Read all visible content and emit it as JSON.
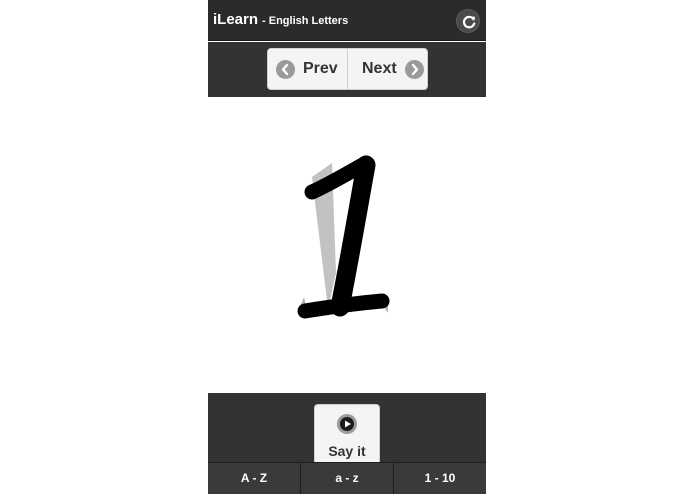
{
  "header": {
    "app_name": "iLearn",
    "subtitle": "- English Letters",
    "refresh_icon": "refresh-icon"
  },
  "nav": {
    "prev_label": "Prev",
    "next_label": "Next",
    "prev_icon": "chevron-left-icon",
    "next_icon": "chevron-right-icon"
  },
  "content": {
    "current_character": "1"
  },
  "footer": {
    "say_label": "Say it",
    "play_icon": "play-icon"
  },
  "tabs": [
    {
      "label": "A - Z"
    },
    {
      "label": "a - z"
    },
    {
      "label": "1 - 10"
    }
  ],
  "colors": {
    "header_bg": "#2b2b2b",
    "bar_bg": "#333333",
    "button_bg": "#f4f4f4",
    "icon_circle": "#9a9a9a"
  }
}
